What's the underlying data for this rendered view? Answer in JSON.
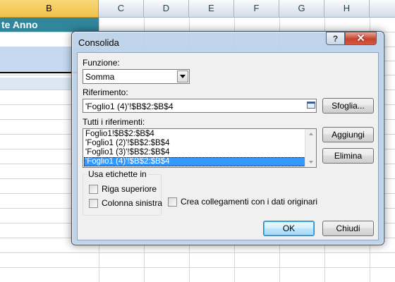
{
  "spreadsheet": {
    "columns": [
      "B",
      "C",
      "D",
      "E",
      "F",
      "G",
      "H"
    ],
    "selected_column": "B",
    "title_cell": "te Anno",
    "colors": {
      "header_fill": "#31869b",
      "selected_column_header": "#f1c14a",
      "range_fill": "#c5d9f1"
    }
  },
  "dialog": {
    "title": "Consolida",
    "help_glyph": "?",
    "close_glyph": "✕",
    "function_label": "Funzione:",
    "function_value": "Somma",
    "reference_label": "Riferimento:",
    "reference_value": "'Foglio1 (4)'!$B$2:$B$4",
    "browse_button": "Sfoglia...",
    "all_references_label": "Tutti i riferimenti:",
    "references": [
      "Foglio1!$B$2:$B$4",
      "'Foglio1 (2)'!$B$2:$B$4",
      "'Foglio1 (3)'!$B$2:$B$4",
      "'Foglio1 (4)'!$B$2:$B$4"
    ],
    "selected_reference_index": 3,
    "add_button": "Aggiungi",
    "delete_button": "Elimina",
    "labels_group": "Usa etichette in",
    "top_row_checkbox": {
      "label": "Riga superiore",
      "checked": false
    },
    "left_column_checkbox": {
      "label": "Colonna sinistra",
      "checked": false
    },
    "links_checkbox": {
      "label": "Crea collegamenti con i dati originari",
      "checked": false
    },
    "ok_button": "OK",
    "cancel_button": "Chiudi",
    "icons": {
      "collapse": "collapse-dialog-icon",
      "dropdown": "chevron-down-icon"
    }
  }
}
